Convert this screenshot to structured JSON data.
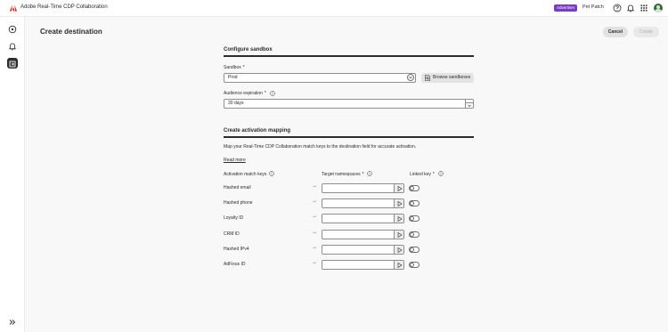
{
  "header": {
    "app_title": "Adobe Real-Time CDP Collaboration",
    "role_badge": "Advertiser",
    "company_name": "Pet Patch",
    "icons": [
      "adobe-logo-icon",
      "help-icon",
      "bell-icon",
      "apps-grid-icon",
      "user-avatar"
    ]
  },
  "left_rail": {
    "items": [
      "home-icon",
      "bell-icon",
      "destinations-icon",
      "expand-icon"
    ],
    "selected": "destinations-icon"
  },
  "page": {
    "title": "Create destination",
    "cancel_label": "Cancel",
    "create_label": "Create"
  },
  "configure_sandbox": {
    "title": "Configure sandbox",
    "sandbox_label": "Sandbox",
    "required_mark": "*",
    "sandbox_value": "Prod",
    "browse_label": "Browse sandboxes",
    "expiration_label": "Audience expiration",
    "expiration_value": "30 days"
  },
  "activation_mapping": {
    "title": "Create activation mapping",
    "description": "Map your Real-Time CDP Collaboration match keys to the destination field for accurate activation.",
    "read_more": "Read more",
    "col_keys": "Activation match keys",
    "col_namespaces": "Target namespaces",
    "col_linked": "Linked key",
    "arrow": "→",
    "rows": [
      {
        "key": "Hashed email",
        "namespace": "",
        "linked": false
      },
      {
        "key": "Hashed phone",
        "namespace": "",
        "linked": false
      },
      {
        "key": "Loyalty ID",
        "namespace": "",
        "linked": false
      },
      {
        "key": "CRM ID",
        "namespace": "",
        "linked": false
      },
      {
        "key": "Hashed IPv4",
        "namespace": "",
        "linked": false
      },
      {
        "key": "AdFixus ID",
        "namespace": "",
        "linked": false
      }
    ]
  },
  "colors": {
    "badge": "#7a3cc6",
    "adobe_red": "#eb1000",
    "text": "#2c2c2c"
  }
}
